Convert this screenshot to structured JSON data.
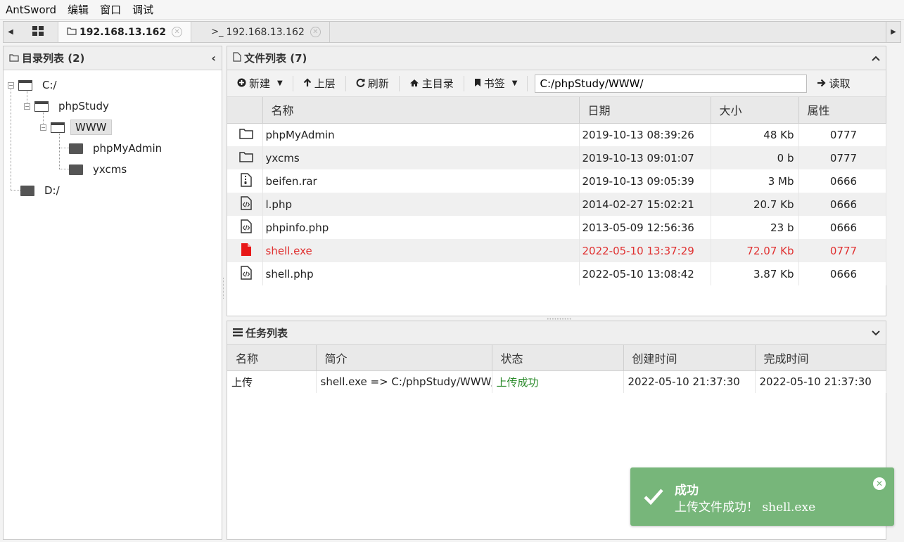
{
  "menubar": {
    "items": [
      "AntSword",
      "编辑",
      "窗口",
      "调试"
    ]
  },
  "tabs": [
    {
      "label": "192.168.13.162",
      "kind": "folder"
    },
    {
      "label": "192.168.13.162",
      "kind": "terminal"
    }
  ],
  "dir_panel": {
    "title": "目录列表 (2)",
    "tree": {
      "c": "C:/",
      "phpstudy": "phpStudy",
      "www": "WWW",
      "phpmyadmin": "phpMyAdmin",
      "yxcms": "yxcms",
      "d": "D:/"
    }
  },
  "file_panel": {
    "title": "文件列表 (7)",
    "toolbar": {
      "new_label": "新建",
      "up_label": "上层",
      "refresh_label": "刷新",
      "home_label": "主目录",
      "bookmark_label": "书签",
      "path_value": "C:/phpStudy/WWW/",
      "read_label": "读取"
    },
    "columns": [
      "名称",
      "日期",
      "大小",
      "属性"
    ],
    "rows": [
      {
        "icon": "folder-icon",
        "name": "phpMyAdmin",
        "date": "2019-10-13 08:39:26",
        "size": "48 Kb",
        "attr": "0777"
      },
      {
        "icon": "folder-icon",
        "name": "yxcms",
        "date": "2019-10-13 09:01:07",
        "size": "0 b",
        "attr": "0777"
      },
      {
        "icon": "archive-icon",
        "name": "beifen.rar",
        "date": "2019-10-13 09:05:39",
        "size": "3 Mb",
        "attr": "0666"
      },
      {
        "icon": "code-file-icon",
        "name": "l.php",
        "date": "2014-02-27 15:02:21",
        "size": "20.7 Kb",
        "attr": "0666"
      },
      {
        "icon": "code-file-icon",
        "name": "phpinfo.php",
        "date": "2013-05-09 12:56:36",
        "size": "23 b",
        "attr": "0666"
      },
      {
        "icon": "file-icon",
        "name": "shell.exe",
        "date": "2022-05-10 13:37:29",
        "size": "72.07 Kb",
        "attr": "0777"
      },
      {
        "icon": "code-file-icon",
        "name": "shell.php",
        "date": "2022-05-10 13:08:42",
        "size": "3.87 Kb",
        "attr": "0666"
      }
    ]
  },
  "task_panel": {
    "title": "任务列表",
    "columns": [
      "名称",
      "简介",
      "状态",
      "创建时间",
      "完成时间"
    ],
    "rows": [
      {
        "name": "上传",
        "desc": "shell.exe => C:/phpStudy/WWW/",
        "status": "上传成功",
        "created": "2022-05-10 21:37:30",
        "finished": "2022-05-10 21:37:30"
      }
    ]
  },
  "toast": {
    "title": "成功",
    "message": "上传文件成功！ shell.exe"
  },
  "colors": {
    "error_row": "#e03030",
    "success_text": "#2a8a2a",
    "toast_bg": "#77b67a"
  }
}
